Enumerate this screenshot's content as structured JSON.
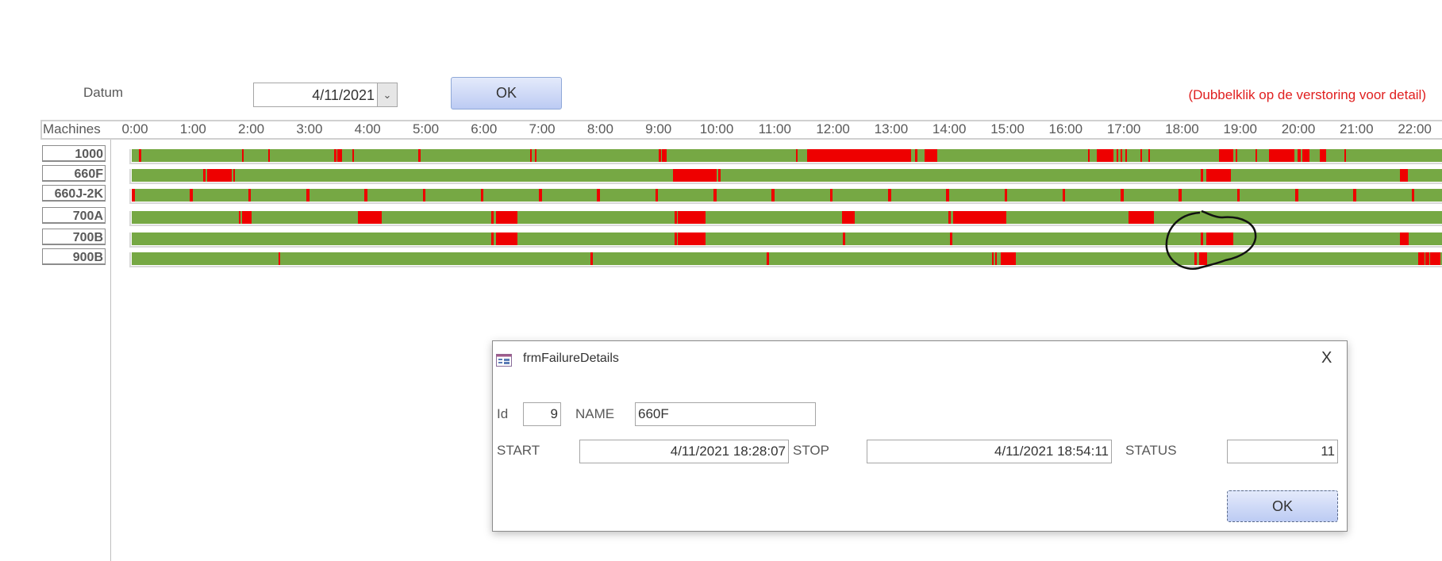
{
  "form": {
    "datum_label": "Datum",
    "date_value": "4/11/2021",
    "ok_label": "OK",
    "hint": "(Dubbelklik op de verstoring voor detail)",
    "machines_header": "Machines"
  },
  "colors": {
    "running": "#76a844",
    "failure": "#ee0000"
  },
  "chart_data": {
    "type": "gantt",
    "x_unit": "hour",
    "xlim": [
      0,
      22.5
    ],
    "hour_labels": [
      "0:00",
      "1:00",
      "2:00",
      "3:00",
      "4:00",
      "5:00",
      "6:00",
      "7:00",
      "8:00",
      "9:00",
      "10:00",
      "11:00",
      "12:00",
      "13:00",
      "14:00",
      "15:00",
      "16:00",
      "17:00",
      "18:00",
      "19:00",
      "20:00",
      "21:00",
      "22:00"
    ],
    "machines": [
      {
        "name": "1000",
        "failures": [
          [
            0.12,
            0.16
          ],
          [
            1.9,
            1.93
          ],
          [
            2.35,
            2.38
          ],
          [
            3.48,
            3.52
          ],
          [
            3.54,
            3.62
          ],
          [
            3.79,
            3.82
          ],
          [
            4.93,
            4.96
          ],
          [
            6.85,
            6.88
          ],
          [
            6.93,
            6.95
          ],
          [
            9.06,
            9.1
          ],
          [
            9.11,
            9.19
          ],
          [
            11.42,
            11.45
          ],
          [
            11.61,
            13.4
          ],
          [
            13.47,
            13.5
          ],
          [
            13.63,
            13.85
          ],
          [
            16.44,
            16.46
          ],
          [
            16.59,
            16.88
          ],
          [
            16.93,
            16.96
          ],
          [
            17.0,
            17.03
          ],
          [
            17.08,
            17.1
          ],
          [
            17.34,
            17.37
          ],
          [
            17.47,
            17.5
          ],
          [
            18.69,
            18.94
          ],
          [
            18.97,
            19.0
          ],
          [
            19.32,
            19.35
          ],
          [
            19.55,
            19.99
          ],
          [
            20.04,
            20.1
          ],
          [
            20.12,
            20.25
          ],
          [
            20.42,
            20.53
          ],
          [
            20.84,
            20.87
          ]
        ]
      },
      {
        "name": "660F",
        "failures": [
          [
            1.23,
            1.27
          ],
          [
            1.3,
            1.72
          ],
          [
            1.74,
            1.77
          ],
          [
            9.31,
            10.06
          ],
          [
            10.08,
            10.12
          ],
          [
            18.38,
            18.42
          ],
          [
            18.47,
            18.9
          ],
          [
            21.8,
            21.94
          ]
        ]
      },
      {
        "name": "660J-2K",
        "failures": [
          [
            0.0,
            0.05
          ],
          [
            1.0,
            1.05
          ],
          [
            2.0,
            2.05
          ],
          [
            3.0,
            3.05
          ],
          [
            4.0,
            4.05
          ],
          [
            5.0,
            5.05
          ],
          [
            6.0,
            6.05
          ],
          [
            7.0,
            7.05
          ],
          [
            8.0,
            8.05
          ],
          [
            9.0,
            9.05
          ],
          [
            10.0,
            10.05
          ],
          [
            11.0,
            11.05
          ],
          [
            12.0,
            12.05
          ],
          [
            13.0,
            13.05
          ],
          [
            14.0,
            14.05
          ],
          [
            15.0,
            15.05
          ],
          [
            16.0,
            16.05
          ],
          [
            17.0,
            17.05
          ],
          [
            18.0,
            18.05
          ],
          [
            19.0,
            19.05
          ],
          [
            20.0,
            20.05
          ],
          [
            21.0,
            21.05
          ],
          [
            22.0,
            22.05
          ]
        ]
      },
      {
        "name": "700A",
        "failures": [
          [
            1.84,
            1.87
          ],
          [
            1.89,
            2.06
          ],
          [
            3.89,
            4.3
          ],
          [
            6.18,
            6.22
          ],
          [
            6.26,
            6.63
          ],
          [
            9.33,
            9.37
          ],
          [
            9.39,
            9.87
          ],
          [
            12.21,
            12.43
          ],
          [
            14.04,
            14.08
          ],
          [
            14.12,
            15.03
          ],
          [
            17.13,
            17.57
          ]
        ]
      },
      {
        "name": "700B",
        "failures": [
          [
            6.18,
            6.22
          ],
          [
            6.26,
            6.63
          ],
          [
            9.33,
            9.37
          ],
          [
            9.39,
            9.87
          ],
          [
            12.22,
            12.26
          ],
          [
            14.07,
            14.1
          ],
          [
            18.38,
            18.42
          ],
          [
            18.47,
            18.94
          ],
          [
            21.8,
            21.95
          ]
        ]
      },
      {
        "name": "900B",
        "failures": [
          [
            2.53,
            2.55
          ],
          [
            7.89,
            7.93
          ],
          [
            10.91,
            10.96
          ],
          [
            14.79,
            14.82
          ],
          [
            14.84,
            14.87
          ],
          [
            14.94,
            15.2
          ],
          [
            18.27,
            18.31
          ],
          [
            18.35,
            18.49
          ],
          [
            22.12,
            22.22
          ],
          [
            22.24,
            22.3
          ],
          [
            22.32,
            22.5
          ]
        ]
      }
    ]
  },
  "dialog": {
    "title": "frmFailureDetails",
    "close": "X",
    "id_label": "Id",
    "id_value": "9",
    "name_label": "NAME",
    "name_value": "660F",
    "start_label": "START",
    "start_value": "4/11/2021 18:28:07",
    "stop_label": "STOP",
    "stop_value": "4/11/2021 18:54:11",
    "status_label": "STATUS",
    "status_value": "11",
    "ok_label": "OK"
  }
}
